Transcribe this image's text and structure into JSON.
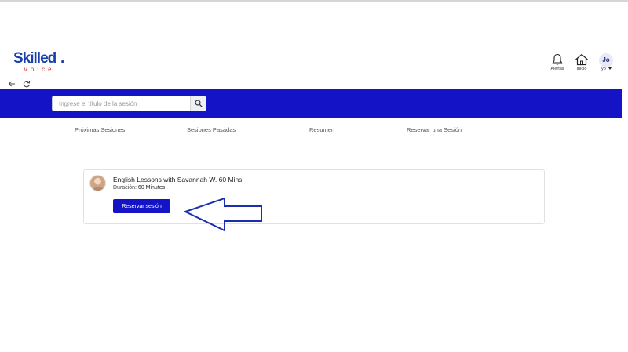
{
  "brand": {
    "name": "Skilled",
    "dot": ".",
    "tagline": "Voice"
  },
  "header": {
    "alerts_label": "Alertas",
    "home_label": "Inicio",
    "user_initials": "Jo",
    "user_menu_label": "yo"
  },
  "search": {
    "placeholder": "Ingrese el título de la sesión",
    "value": ""
  },
  "tabs": [
    {
      "label": "Próximas Sesiones"
    },
    {
      "label": "Sesiones Pasadas"
    },
    {
      "label": "Resumen"
    },
    {
      "label": "Reservar una Sesión",
      "active": true
    }
  ],
  "session": {
    "title": "English Lessons with Savannah W. 60 Mins.",
    "duration_label": "Duración:",
    "duration_value": "60 Minutes",
    "book_button": "Reservar sesión"
  },
  "colors": {
    "brand_blue": "#1414c6",
    "logo_blue": "#1a3fa8",
    "logo_red": "#d0342c",
    "arrow_blue": "#1a2fb0"
  },
  "icons": [
    "bell-icon",
    "home-icon",
    "back-arrow-icon",
    "refresh-icon",
    "search-icon",
    "caret-down-icon",
    "pointing-arrow-icon"
  ]
}
